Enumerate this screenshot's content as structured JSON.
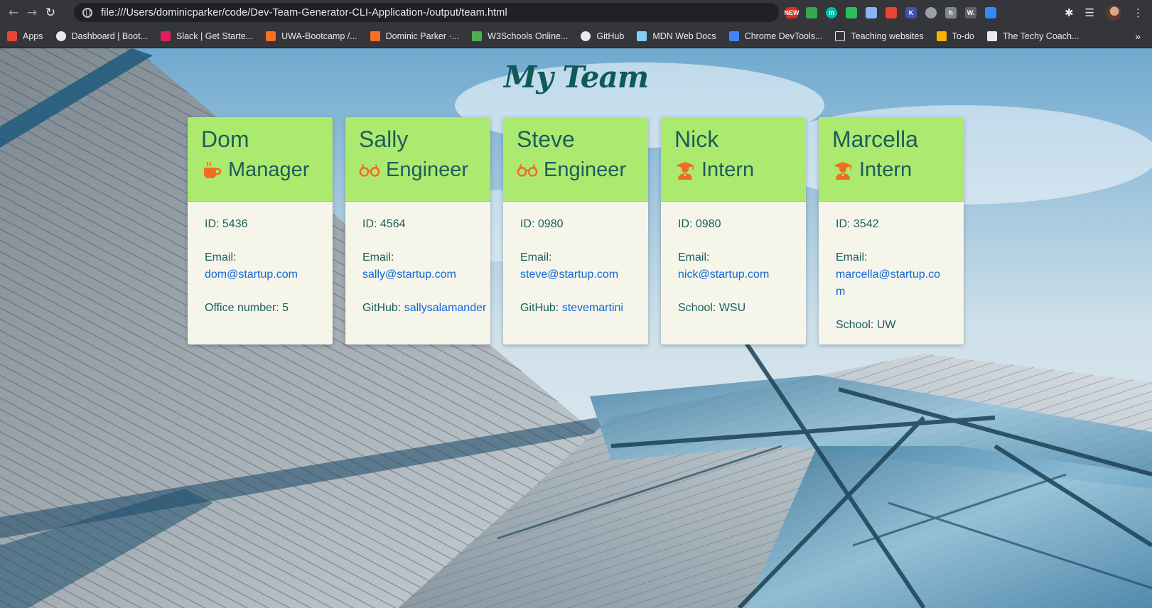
{
  "browser": {
    "url": "file:///Users/dominicparker/code/Dev-Team-Generator-CLI-Application-/output/team.html",
    "bookmarks": [
      {
        "label": "Apps",
        "icon": "apps-grid-icon",
        "color": "#ea4335"
      },
      {
        "label": "Dashboard | Boot...",
        "icon": "globe-icon",
        "color": "#e8eaed"
      },
      {
        "label": "Slack | Get Starte...",
        "icon": "slack-icon",
        "color": "#e01e5a"
      },
      {
        "label": "UWA-Bootcamp /...",
        "icon": "gitlab-icon",
        "color": "#fc6d26"
      },
      {
        "label": "Dominic Parker ·...",
        "icon": "gitlab-icon",
        "color": "#fc6d26"
      },
      {
        "label": "W3Schools Online...",
        "icon": "w3schools-icon",
        "color": "#4caf50"
      },
      {
        "label": "GitHub",
        "icon": "github-icon",
        "color": "#e8eaed"
      },
      {
        "label": "MDN Web Docs",
        "icon": "mdn-icon",
        "color": "#83d0f2"
      },
      {
        "label": "Chrome DevTools...",
        "icon": "chrome-devtools-icon",
        "color": "#4285f4"
      },
      {
        "label": "Teaching websites",
        "icon": "folder-icon",
        "color": "#e8eaed"
      },
      {
        "label": "To-do",
        "icon": "todo-icon",
        "color": "#f4b400"
      },
      {
        "label": "The Techy Coach...",
        "icon": "techy-coach-icon",
        "color": "#e8eaed"
      }
    ],
    "extensions": [
      {
        "name": "new-badge-extension-icon",
        "color": "#d93025",
        "text": "NEW"
      },
      {
        "name": "google-drive-extension-icon",
        "color": "#34a853",
        "text": ""
      },
      {
        "name": "m-extension-icon",
        "color": "#00bfa5",
        "text": "m"
      },
      {
        "name": "evernote-extension-icon",
        "color": "#2dbe60",
        "text": ""
      },
      {
        "name": "eye-extension-icon",
        "color": "#8ab4f8",
        "text": ""
      },
      {
        "name": "video-extension-icon",
        "color": "#ea4335",
        "text": ""
      },
      {
        "name": "k-extension-icon",
        "color": "#3f51b5",
        "text": "K"
      },
      {
        "name": "grey-circle-extension-icon",
        "color": "#9aa0a6",
        "text": ""
      },
      {
        "name": "h-extension-icon",
        "color": "#80868b",
        "text": "h"
      },
      {
        "name": "w-extension-icon",
        "color": "#5f6368",
        "text": "W."
      },
      {
        "name": "zoom-extension-icon",
        "color": "#2d8cff",
        "text": ""
      }
    ]
  },
  "page": {
    "title": "My Team",
    "accent": "#acea6f",
    "link_color": "#1166d6",
    "icon_color": "#f26b21"
  },
  "employees": [
    {
      "name": "Dom",
      "role": "Manager",
      "role_icon": "coffee-mug-icon",
      "id": "ID: 5436",
      "email_label": "Email:",
      "email": "dom@startup.com",
      "extra_label": "Office number: 5",
      "extra_value": ""
    },
    {
      "name": "Sally",
      "role": "Engineer",
      "role_icon": "glasses-icon",
      "id": "ID: 4564",
      "email_label": "Email:",
      "email": "sally@startup.com",
      "extra_label": "GitHub:",
      "extra_value": "sallysalamander"
    },
    {
      "name": "Steve",
      "role": "Engineer",
      "role_icon": "glasses-icon",
      "id": "ID: 0980",
      "email_label": "Email:",
      "email": "steve@startup.com",
      "extra_label": "GitHub:",
      "extra_value": "stevemartini"
    },
    {
      "name": "Nick",
      "role": "Intern",
      "role_icon": "graduate-icon",
      "id": "ID: 0980",
      "email_label": "Email:",
      "email": "nick@startup.com",
      "extra_label": "School: WSU",
      "extra_value": ""
    },
    {
      "name": "Marcella",
      "role": "Intern",
      "role_icon": "graduate-icon",
      "id": "ID: 3542",
      "email_label": "Email:",
      "email": "marcella@startup.com",
      "extra_label": "School: UW",
      "extra_value": ""
    }
  ]
}
